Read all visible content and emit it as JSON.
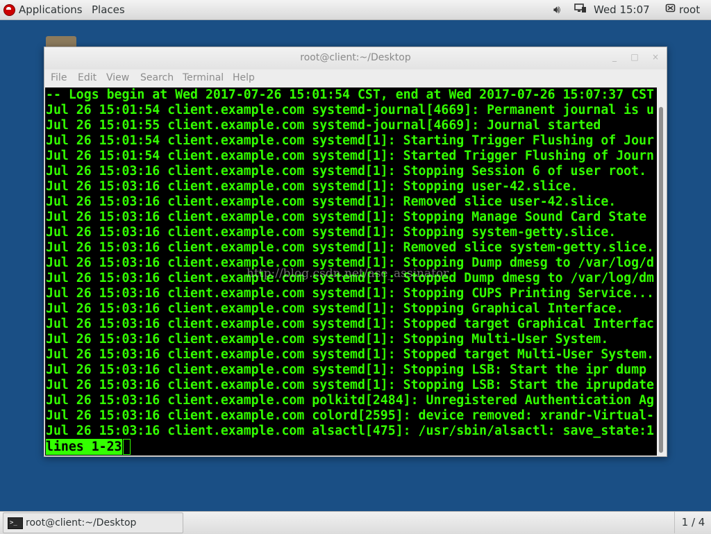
{
  "topbar": {
    "applications_label": "Applications",
    "places_label": "Places",
    "clock": "Wed 15:07",
    "user": "root",
    "volume_icon": "volume-icon",
    "network_icon": "network-icon",
    "user_icon": "user-icon"
  },
  "window": {
    "title": "root@client:~/Desktop",
    "menu": [
      "File",
      "Edit",
      "View",
      "Search",
      "Terminal",
      "Help"
    ],
    "controls": {
      "minimize": "_",
      "maximize": "□",
      "close": "×"
    }
  },
  "terminal": {
    "text_color": "#33ff00",
    "background": "#000000",
    "lines": [
      "-- Logs begin at Wed 2017-07-26 15:01:54 CST, end at Wed 2017-07-26 15:07:37 CST",
      "Jul 26 15:01:54 client.example.com systemd-journal[4669]: Permanent journal is u",
      "Jul 26 15:01:55 client.example.com systemd-journal[4669]: Journal started",
      "Jul 26 15:01:54 client.example.com systemd[1]: Starting Trigger Flushing of Jour",
      "Jul 26 15:01:54 client.example.com systemd[1]: Started Trigger Flushing of Journ",
      "Jul 26 15:03:16 client.example.com systemd[1]: Stopping Session 6 of user root.",
      "Jul 26 15:03:16 client.example.com systemd[1]: Stopping user-42.slice.",
      "Jul 26 15:03:16 client.example.com systemd[1]: Removed slice user-42.slice.",
      "Jul 26 15:03:16 client.example.com systemd[1]: Stopping Manage Sound Card State",
      "Jul 26 15:03:16 client.example.com systemd[1]: Stopping system-getty.slice.",
      "Jul 26 15:03:16 client.example.com systemd[1]: Removed slice system-getty.slice.",
      "Jul 26 15:03:16 client.example.com systemd[1]: Stopping Dump dmesg to /var/log/d",
      "Jul 26 15:03:16 client.example.com systemd[1]: Stopped Dump dmesg to /var/log/dm",
      "Jul 26 15:03:16 client.example.com systemd[1]: Stopping CUPS Printing Service...",
      "Jul 26 15:03:16 client.example.com systemd[1]: Stopping Graphical Interface.",
      "Jul 26 15:03:16 client.example.com systemd[1]: Stopped target Graphical Interfac",
      "Jul 26 15:03:16 client.example.com systemd[1]: Stopping Multi-User System.",
      "Jul 26 15:03:16 client.example.com systemd[1]: Stopped target Multi-User System.",
      "Jul 26 15:03:16 client.example.com systemd[1]: Stopping LSB: Start the ipr dump",
      "Jul 26 15:03:16 client.example.com systemd[1]: Stopping LSB: Start the iprupdate",
      "Jul 26 15:03:16 client.example.com polkitd[2484]: Unregistered Authentication Ag",
      "Jul 26 15:03:16 client.example.com colord[2595]: device removed: xrandr-Virtual-",
      "Jul 26 15:03:16 client.example.com alsactl[475]: /usr/sbin/alsactl: save_state:1"
    ],
    "status": "lines 1-23",
    "watermark": "http://blog.csdn.net/ase_assinator"
  },
  "taskbar": {
    "task_label": "root@client:~/Desktop",
    "task_icon": "terminal-icon",
    "workspace": "1 / 4"
  }
}
